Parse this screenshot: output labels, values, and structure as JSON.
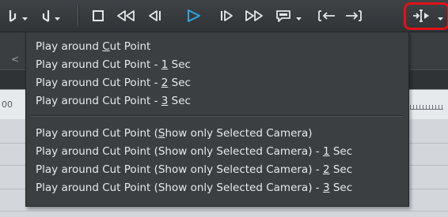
{
  "menu": {
    "items": [
      {
        "pre": "Play around ",
        "acc": "C",
        "post": "ut Point"
      },
      {
        "pre": "Play around Cut Point - ",
        "acc": "1",
        "post": " Sec"
      },
      {
        "pre": "Play around Cut Point - ",
        "acc": "2",
        "post": " Sec"
      },
      {
        "pre": "Play around Cut Point - ",
        "acc": "3",
        "post": " Sec"
      },
      {
        "pre": "Play around Cut Point (",
        "acc": "S",
        "post": "how only Selected Camera)"
      },
      {
        "pre": "Play around Cut Point (Show only Selected Camera) - ",
        "acc": "1",
        "post": " Sec"
      },
      {
        "pre": "Play around Cut Point (Show only Selected Camera) - ",
        "acc": "2",
        "post": " Sec"
      },
      {
        "pre": "Play around Cut Point (Show only Selected Camera) - ",
        "acc": "3",
        "post": " Sec"
      }
    ]
  },
  "background": {
    "ruler_fragment": "00",
    "left_fragment": "<"
  },
  "colors": {
    "toolbar": "#353a3d",
    "menu_bg": "#3b3f42",
    "menu_text": "#e8eaec",
    "play_accent": "#2aa8e0",
    "highlight": "#e0121a"
  },
  "icons": [
    "set-in-icon",
    "set-out-icon",
    "stop-icon",
    "rewind-icon",
    "step-back-icon",
    "play-icon",
    "step-forward-icon",
    "fast-forward-icon",
    "preview-icon",
    "jump-in-icon",
    "jump-out-icon",
    "play-around-cut-point-icon"
  ]
}
